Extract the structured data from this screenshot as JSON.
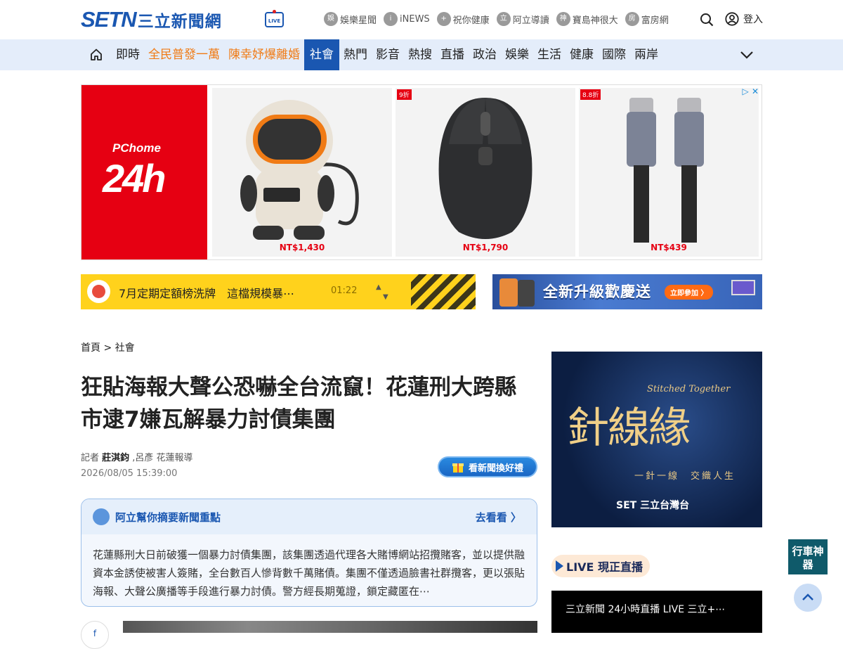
{
  "header": {
    "logo_en": "SETN",
    "logo_cn": "三立新聞網",
    "live_badge": "LIVE",
    "top_links": [
      {
        "icon": "entertainment-icon",
        "glyph": "娛",
        "label": "娛樂星聞"
      },
      {
        "icon": "inews-icon",
        "glyph": "i",
        "label": "iNEWS"
      },
      {
        "icon": "health-icon",
        "glyph": "+",
        "label": "祝你健康"
      },
      {
        "icon": "guide-icon",
        "glyph": "立",
        "label": "阿立導讀"
      },
      {
        "icon": "temple-icon",
        "glyph": "神",
        "label": "寶島神很大"
      },
      {
        "icon": "house-icon",
        "glyph": "房",
        "label": "富房網"
      }
    ],
    "login_label": "登入"
  },
  "nav": {
    "items": [
      {
        "label": "即時",
        "style": ""
      },
      {
        "label": "全民普發一萬",
        "style": "hl"
      },
      {
        "label": "陳幸妤爆離婚",
        "style": "hl"
      },
      {
        "label": "社會",
        "style": "active"
      },
      {
        "label": "熱門",
        "style": ""
      },
      {
        "label": "影音",
        "style": ""
      },
      {
        "label": "熱搜",
        "style": ""
      },
      {
        "label": "直播",
        "style": ""
      },
      {
        "label": "政治",
        "style": ""
      },
      {
        "label": "娛樂",
        "style": ""
      },
      {
        "label": "生活",
        "style": ""
      },
      {
        "label": "健康",
        "style": ""
      },
      {
        "label": "國際",
        "style": ""
      },
      {
        "label": "兩岸",
        "style": ""
      }
    ]
  },
  "ad_banner": {
    "brand_top": "PChome",
    "brand_bottom": "24h",
    "products": [
      {
        "price": "NT$1,430",
        "discount": ""
      },
      {
        "price": "NT$1,790",
        "discount": "9折"
      },
      {
        "price": "NT$439",
        "discount": "8.8折"
      }
    ]
  },
  "ticker": {
    "text": "7月定期定額榜洗牌　這檔規模暴⋯",
    "time": "01:22"
  },
  "promo_ad": {
    "text": "全新升級歡慶送",
    "button": "立即參加 〉"
  },
  "article": {
    "breadcrumb": "首頁 > 社會",
    "title": "狂貼海報大聲公恐嚇全台流竄！花蓮刑大跨縣市逮7嫌瓦解暴力討債集團",
    "byline_prefix": "記者 ",
    "author": "莊淇鈞",
    "byline_suffix": " ,呂彥 花蓮報導",
    "datetime": "2026/08/05 15:39:00",
    "gift_button": "看新聞換好禮"
  },
  "summary": {
    "title": "阿立幫你摘要新聞重點",
    "more": "去看看 〉",
    "body": "花蓮縣刑大日前破獲一個暴力討債集團，該集團透過代理各大賭博網站招攬賭客，並以提供融資本金誘使被害人簽賭，全台數百人慘背數千萬賭債。集團不僅透過臉書社群攬客，更以張貼海報、大聲公廣播等手段進行暴力討債。警方經長期蒐證，鎖定藏匿在⋯"
  },
  "sidebar": {
    "ad_subtitle": "Stitched Together",
    "ad_title": "針線緣",
    "ad_tagline": "一針一線　交織人生",
    "ad_brand": "SET 三立台灣台",
    "live_label": "LIVE 現正直播",
    "live_video_title": "三立新聞 24小時直播 LIVE 三立+⋯"
  },
  "float_badge": "行車神器"
}
